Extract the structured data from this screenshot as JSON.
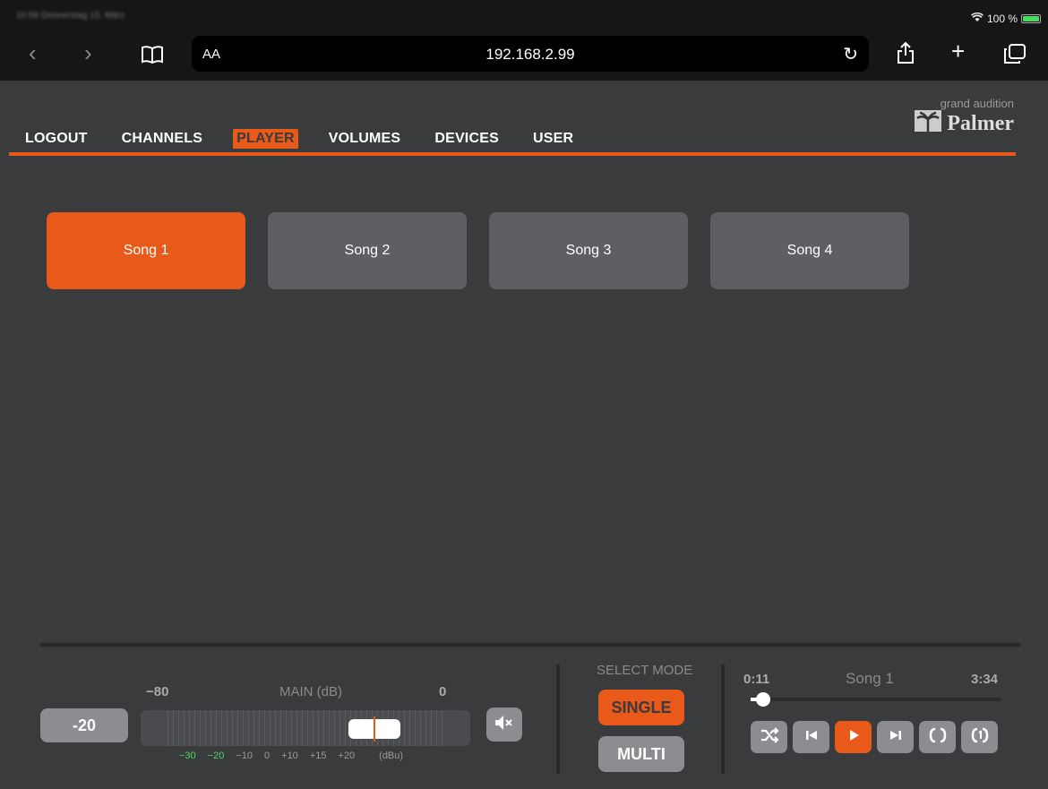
{
  "browser": {
    "status_left": "10:58  Donnerstag 15. März",
    "battery": "100 %",
    "aa_label": "AA",
    "url": "192.168.2.99"
  },
  "app": {
    "menu": [
      {
        "label": "LOGOUT",
        "active": false
      },
      {
        "label": "CHANNELS",
        "active": false
      },
      {
        "label": "PLAYER",
        "active": true
      },
      {
        "label": "VOLUMES",
        "active": false
      },
      {
        "label": "DEVICES",
        "active": false
      },
      {
        "label": "USER",
        "active": false
      }
    ],
    "brand": {
      "tagline": "grand audition",
      "name": "Palmer"
    },
    "songs": [
      {
        "label": "Song 1",
        "active": true
      },
      {
        "label": "Song 2",
        "active": false
      },
      {
        "label": "Song 3",
        "active": false
      },
      {
        "label": "Song 4",
        "active": false
      }
    ],
    "colors": {
      "accent": "#e8591a",
      "button": "#8c8d90",
      "background": "#3a3b3d"
    }
  },
  "volume": {
    "value": "-20",
    "min_label": "−80",
    "title": "MAIN (dB)",
    "max_label": "0",
    "scale": [
      "−30",
      "−20",
      "−10",
      "0",
      "+10",
      "+15",
      "+20",
      "(dBu)"
    ],
    "mute_icon": "speaker-mute-icon"
  },
  "mode": {
    "title": "SELECT MODE",
    "single_label": "SINGLE",
    "multi_label": "MULTI"
  },
  "player": {
    "current_time": "0:11",
    "track": "Song 1",
    "total_time": "3:34",
    "progress_fraction": 0.05,
    "controls": [
      "shuffle-icon",
      "previous-icon",
      "play-icon",
      "next-icon",
      "repeat-icon",
      "repeat-one-icon"
    ]
  }
}
